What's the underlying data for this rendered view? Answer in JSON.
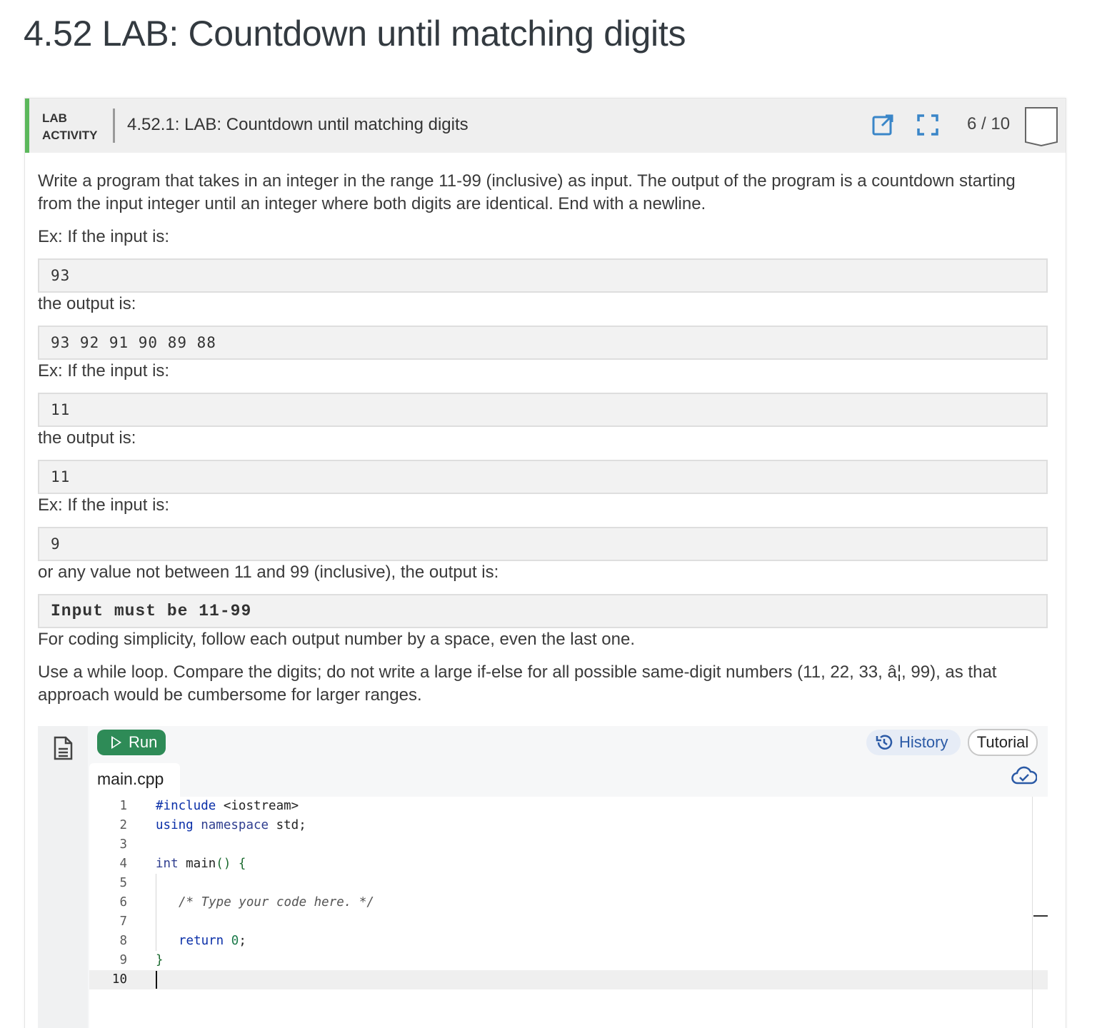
{
  "page": {
    "title": "4.52 LAB: Countdown until matching digits"
  },
  "lab": {
    "label": "LAB ACTIVITY",
    "title": "4.52.1: LAB: Countdown until matching digits",
    "score": "6 / 10",
    "icons": [
      "open-external-icon",
      "fullscreen-icon",
      "score-badge-icon"
    ]
  },
  "description": {
    "p1": "Write a program that takes in an integer in the range 11-99 (inclusive) as input. The output of the program is a countdown starting from the input integer until an integer where both digits are identical. End with a newline.",
    "ex1_label": "Ex: If the input is:",
    "ex1_input": "93",
    "ex1_out_label": "the output is:",
    "ex1_output": "93 92 91 90 89 88",
    "ex2_label": "Ex: If the input is:",
    "ex2_input": "11",
    "ex2_out_label": "the output is:",
    "ex2_output": "11",
    "ex3_label": "Ex: If the input is:",
    "ex3_input": "9",
    "ex3_out_label": "or any value not between 11 and 99 (inclusive), the output is:",
    "ex3_output": "Input must be 11-99",
    "p2": "For coding simplicity, follow each output number by a space, even the last one.",
    "p3": "Use a while loop. Compare the digits; do not write a large if-else for all possible same-digit numbers (11, 22, 33, â¦, 99), as that approach would be cumbersome for larger ranges."
  },
  "ide": {
    "run_label": "Run",
    "history_label": "History",
    "tutorial_label": "Tutorial",
    "file_tab": "main.cpp",
    "icons": [
      "document-icon",
      "play-icon",
      "history-icon",
      "cloud-check-icon"
    ],
    "lines": [
      {
        "n": "1",
        "code": "#include <iostream>"
      },
      {
        "n": "2",
        "code": "using namespace std;"
      },
      {
        "n": "3",
        "code": ""
      },
      {
        "n": "4",
        "code": "int main() {"
      },
      {
        "n": "5",
        "code": ""
      },
      {
        "n": "6",
        "code": "/* Type your code here. */"
      },
      {
        "n": "7",
        "code": ""
      },
      {
        "n": "8",
        "code": "return 0;"
      },
      {
        "n": "9",
        "code": "}"
      },
      {
        "n": "10",
        "code": ""
      }
    ]
  },
  "colors": {
    "accent_green": "#5cb85c",
    "run_green": "#2e8b57",
    "link_blue": "#2b5aa6"
  }
}
